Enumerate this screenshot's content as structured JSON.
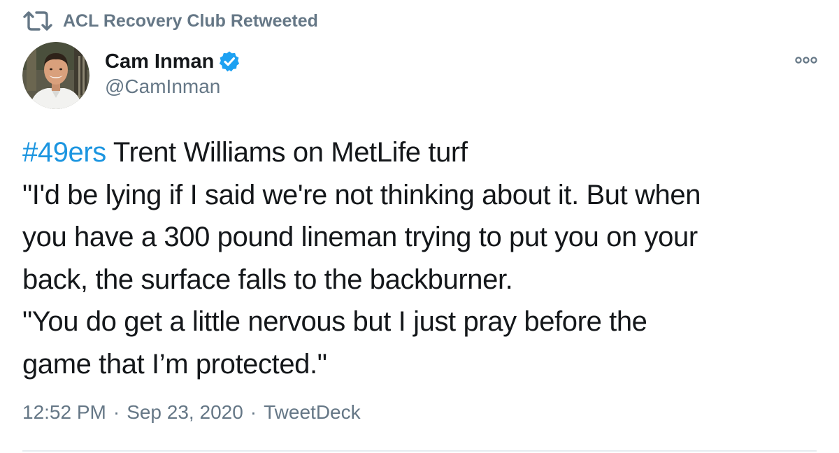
{
  "retweet": {
    "icon": "retweet-icon",
    "label": "ACL Recovery Club Retweeted"
  },
  "author": {
    "name": "Cam Inman",
    "handle": "@CamInman",
    "verified": true,
    "avatar": "avatar-photo"
  },
  "tweet": {
    "lines": [
      {
        "hashtag": "#49ers",
        "text": " Trent Williams on MetLife turf"
      },
      {
        "text": "\"I'd be lying if I said we're not thinking about it. But when"
      },
      {
        "text": "you have a 300 pound lineman trying to put you on your"
      },
      {
        "text": "back, the surface falls to the backburner."
      },
      {
        "text": "\"You do get a little nervous but I just pray before the"
      },
      {
        "text": "game that I’m protected.\""
      }
    ]
  },
  "meta": {
    "time": "12:52 PM",
    "date": "Sep 23, 2020",
    "source": "TweetDeck",
    "separator": "·"
  },
  "colors": {
    "text": "#14171a",
    "secondary": "#657786",
    "link": "#1b95e0",
    "verified": "#1da1f2"
  }
}
